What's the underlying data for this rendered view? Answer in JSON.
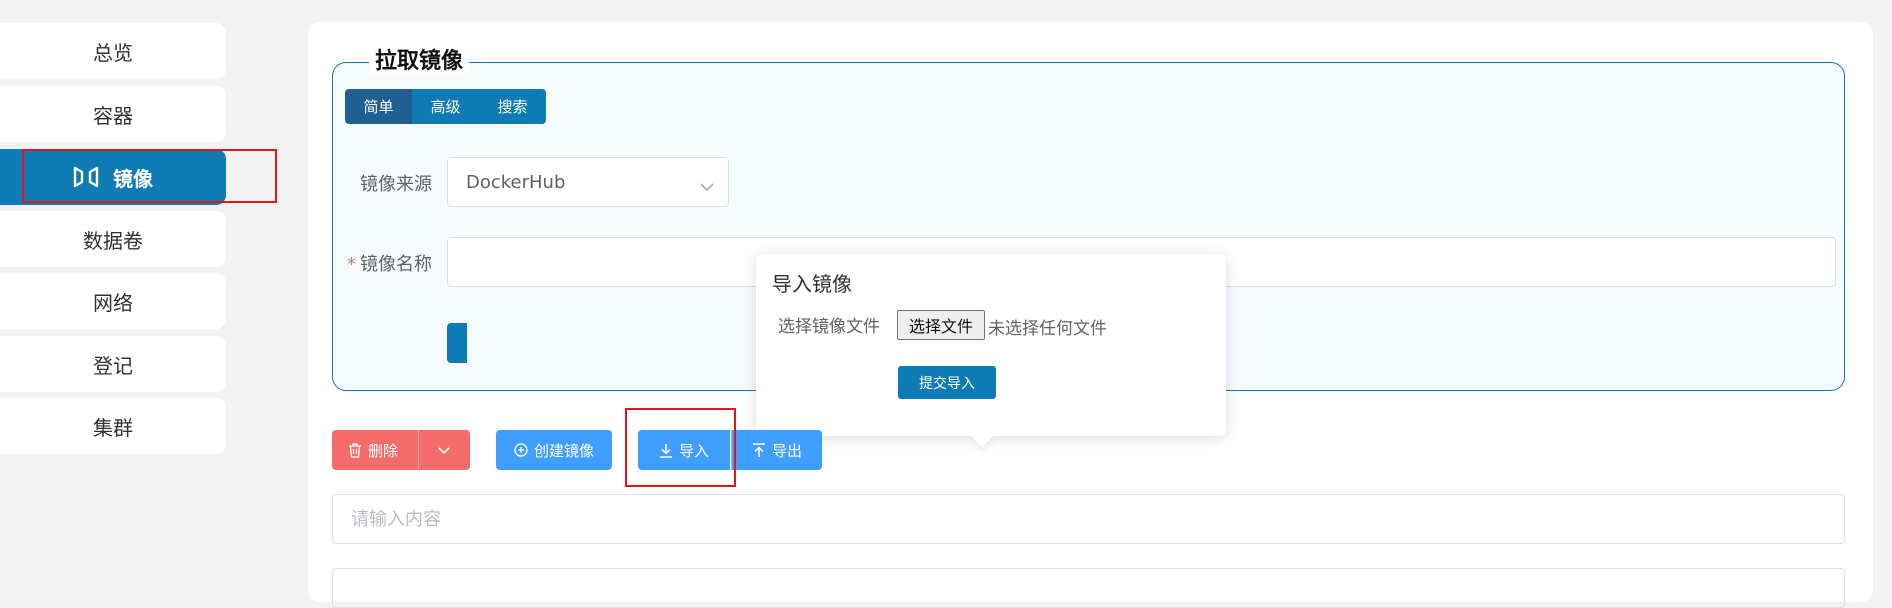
{
  "sidebar": {
    "items": [
      {
        "label": "总览"
      },
      {
        "label": "容器"
      },
      {
        "label": "镜像"
      },
      {
        "label": "数据卷"
      },
      {
        "label": "网络"
      },
      {
        "label": "登记"
      },
      {
        "label": "集群"
      }
    ]
  },
  "pull": {
    "legend": "拉取镜像",
    "tabs": [
      {
        "label": "简单"
      },
      {
        "label": "高级"
      },
      {
        "label": "搜索"
      }
    ],
    "source_label": "镜像来源",
    "source_value": "DockerHub",
    "name_required": "*",
    "name_label": "镜像名称"
  },
  "import_popover": {
    "title": "导入镜像",
    "file_label": "选择镜像文件",
    "file_button": "选择文件",
    "file_status": "未选择任何文件",
    "submit": "提交导入"
  },
  "toolbar": {
    "delete": "删除",
    "create": "创建镜像",
    "import": "导入",
    "export": "导出"
  },
  "search": {
    "placeholder": "请输入内容"
  },
  "colors": {
    "primary": "#0f7bb4",
    "blue": "#409eff",
    "danger": "#f56c6c",
    "highlight": "#e4141b"
  }
}
